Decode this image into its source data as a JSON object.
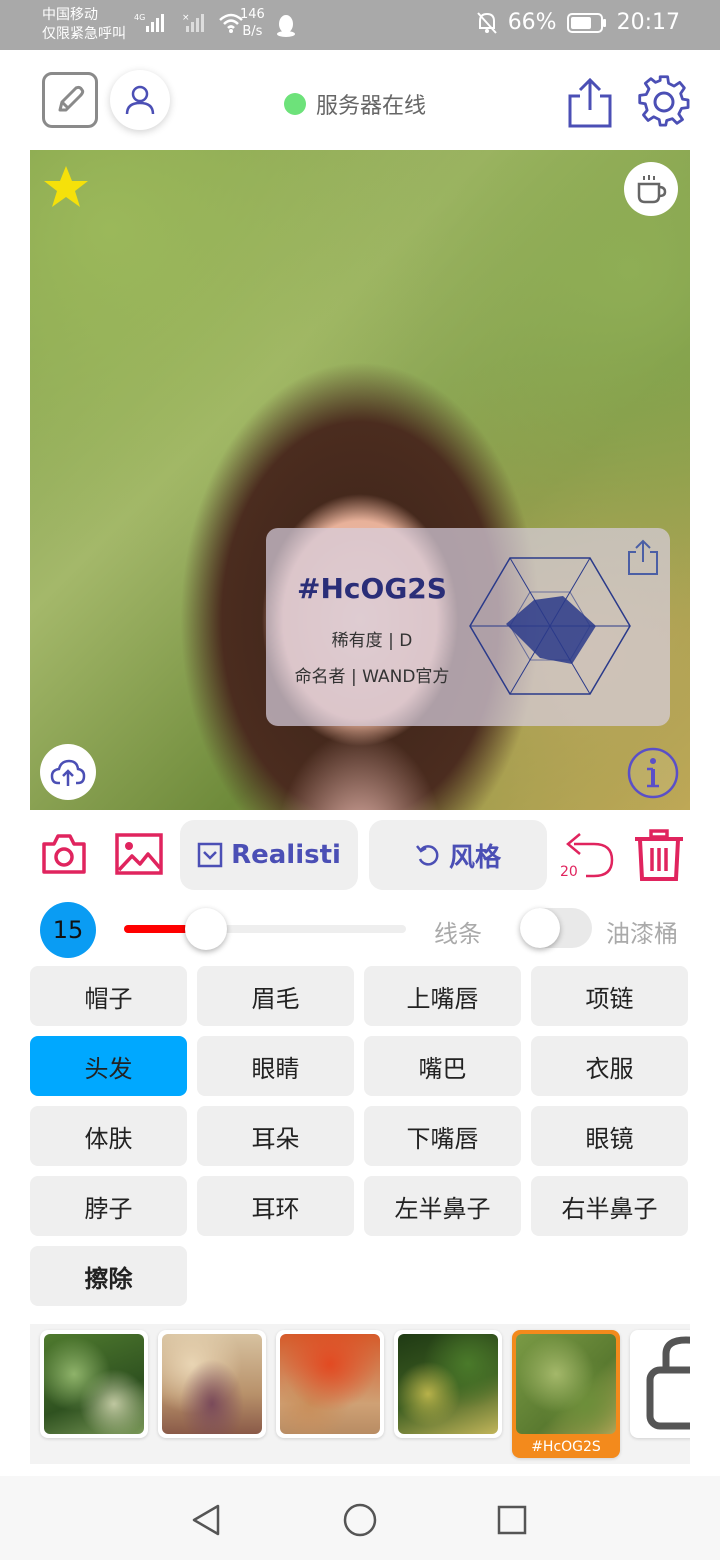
{
  "status_bar": {
    "carrier": "中国移动",
    "emergency": "仅限紧急呼叫",
    "net_speed_value": "146",
    "net_speed_unit": "B/s",
    "battery": "66%",
    "time": "20:17"
  },
  "header": {
    "server_status": "服务器在线",
    "status_color": "#6de27a"
  },
  "card": {
    "title": "#HcOG2S",
    "rarity": "稀有度 | D",
    "namer": "命名者 | WAND官方"
  },
  "toolbar": {
    "model_label": "Realisti",
    "style_label": "风格",
    "undo_count": "20"
  },
  "brush": {
    "size": "15",
    "slider_fraction": 0.29,
    "line_label": "线条",
    "bucket_label": "油漆桶",
    "bucket_enabled": false
  },
  "parts": [
    {
      "label": "帽子"
    },
    {
      "label": "眉毛"
    },
    {
      "label": "上嘴唇"
    },
    {
      "label": "项链"
    },
    {
      "label": "头发",
      "active": true
    },
    {
      "label": "眼睛"
    },
    {
      "label": "嘴巴"
    },
    {
      "label": "衣服"
    },
    {
      "label": "体肤"
    },
    {
      "label": "耳朵"
    },
    {
      "label": "下嘴唇"
    },
    {
      "label": "眼镜"
    },
    {
      "label": "脖子"
    },
    {
      "label": "耳环"
    },
    {
      "label": "左半鼻子"
    },
    {
      "label": "右半鼻子"
    },
    {
      "label": "擦除",
      "erase": true
    }
  ],
  "styles": {
    "selected_label": "#HcOG2S"
  },
  "colors": {
    "accent_blue": "#00a8ff",
    "brand_indigo": "#4b4fb5",
    "accent_pink": "#e0245e",
    "selected_orange": "#f38a1c"
  }
}
